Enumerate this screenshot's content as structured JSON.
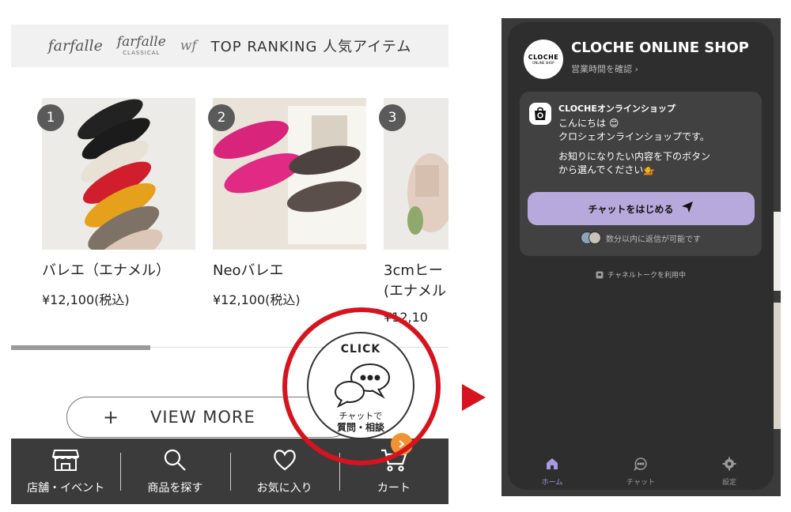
{
  "left_screen": {
    "brands": {
      "brand1": "farfalle",
      "brand2_main": "farfalle",
      "brand2_sub": "CLASSICAL",
      "brand3": "wf"
    },
    "ranking_title": "TOP RANKING  人気アイテム",
    "products": [
      {
        "rank": "1",
        "name": "バレエ（エナメル）",
        "price": "¥12,100(税込)"
      },
      {
        "rank": "2",
        "name": "Neoバレエ",
        "price": "¥12,100(税込)"
      },
      {
        "rank": "3",
        "name": "3cmヒー",
        "name_line2": "(エナメル",
        "price": "¥12,10"
      }
    ],
    "view_more": {
      "plus": "+",
      "label": "VIEW MORE"
    },
    "chat_launcher": {
      "click": "CLICK",
      "sub1": "チャットで",
      "sub2": "質問・相談"
    },
    "bottom_nav": [
      {
        "label": "店舗・イベント",
        "icon": "store-icon"
      },
      {
        "label": "商品を探す",
        "icon": "search-icon"
      },
      {
        "label": "お気に入り",
        "icon": "heart-icon"
      },
      {
        "label": "カート",
        "icon": "cart-icon"
      }
    ],
    "colors": {
      "highlight_red": "#d7141e",
      "nav_bg": "#3b3b3b",
      "cart_badge": "#f19233"
    }
  },
  "chat_panel": {
    "logo_text": "CLOCHE",
    "logo_sub": "ONLINE SHOP",
    "shop_name": "CLOCHE ONLINE SHOP",
    "hours_link": "営業時間を確認 ›",
    "bot_name": "CLOCHEオンラインショップ",
    "message_lines": [
      "こんにちは 😊",
      "クロシェオンラインショップです。",
      "お知りになりたい内容を下のボタン",
      "から選んでください💁"
    ],
    "start_chat": "チャットをはじめる",
    "reply_time": "数分以内に返信が可能です",
    "powered_by": "チャネルトークを利用中",
    "tabs": [
      {
        "label": "ホーム",
        "icon": "home-icon",
        "active": true
      },
      {
        "label": "チャット",
        "icon": "chat-icon",
        "active": false
      },
      {
        "label": "設定",
        "icon": "gear-icon",
        "active": false
      }
    ],
    "colors": {
      "panel_bg": "#2e2e2e",
      "card_bg": "#414141",
      "button": "#b8a9dc",
      "active_tab": "#a99ae0"
    }
  }
}
